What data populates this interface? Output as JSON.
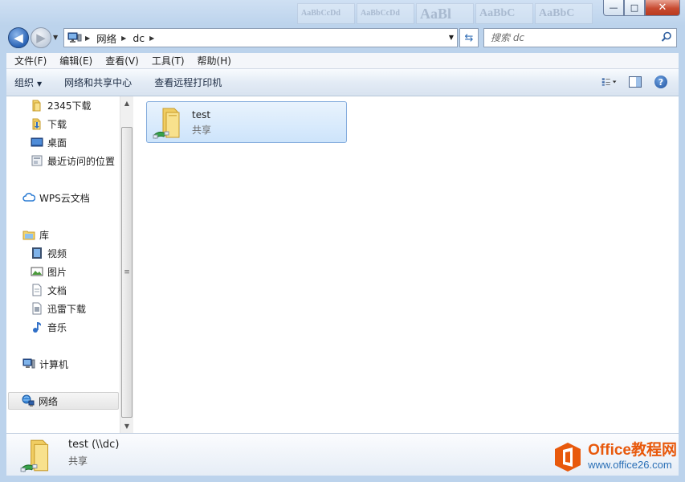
{
  "window": {
    "minimize_glyph": "—",
    "maximize_glyph": "□",
    "close_glyph": "✕",
    "background_ribbon": [
      "AaBbCcDd",
      "AaBbCcDd",
      "AaBl",
      "AaBbC",
      "AaBbC"
    ]
  },
  "address": {
    "crumbs": [
      "网络",
      "dc"
    ],
    "search_placeholder": "搜索 dc"
  },
  "menu": [
    "文件(F)",
    "编辑(E)",
    "查看(V)",
    "工具(T)",
    "帮助(H)"
  ],
  "commands": {
    "organize": "组织",
    "network_center": "网络和共享中心",
    "remote_printers": "查看远程打印机"
  },
  "nav": {
    "items": [
      {
        "label": "2345下载",
        "icon": "folder-icon"
      },
      {
        "label": "下载",
        "icon": "download-folder-icon"
      },
      {
        "label": "桌面",
        "icon": "desktop-icon"
      },
      {
        "label": "最近访问的位置",
        "icon": "recent-places-icon"
      },
      {
        "label": "WPS云文档",
        "icon": "cloud-icon"
      },
      {
        "label": "库",
        "icon": "library-icon"
      },
      {
        "label": "视频",
        "icon": "video-library-icon"
      },
      {
        "label": "图片",
        "icon": "pictures-library-icon"
      },
      {
        "label": "文档",
        "icon": "documents-library-icon"
      },
      {
        "label": "迅雷下载",
        "icon": "thunder-download-icon"
      },
      {
        "label": "音乐",
        "icon": "music-library-icon"
      },
      {
        "label": "计算机",
        "icon": "computer-icon"
      },
      {
        "label": "网络",
        "icon": "network-icon"
      }
    ]
  },
  "content": {
    "items": [
      {
        "name": "test",
        "type": "共享"
      }
    ]
  },
  "details": {
    "title": "test (\\\\dc)",
    "subtitle": "共享"
  },
  "watermark": {
    "brand": "Office教程网",
    "url": "www.office26.com"
  },
  "colors": {
    "selection_fill": "#cde4fb",
    "selection_border": "#84acdd",
    "watermark_orange": "#e8590c",
    "watermark_blue": "#2a6fb6"
  }
}
